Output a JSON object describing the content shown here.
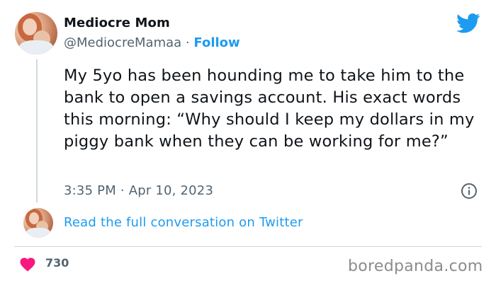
{
  "author": {
    "display_name": "Mediocre Mom",
    "handle": "@MediocreMamaa",
    "separator": "·",
    "follow_label": "Follow"
  },
  "tweet": {
    "text": "My 5yo has been hounding me to take him to the bank to open a savings account. His exact words this morning: “Why should I keep my dollars in my piggy bank when they can be working for me?”",
    "timestamp": "3:35 PM · Apr 10, 2023"
  },
  "conversation_link": "Read the full conversation on Twitter",
  "likes": {
    "count": "730"
  },
  "watermark": "boredpanda.com",
  "icons": {
    "brand": "twitter-bird-icon",
    "info": "info-icon",
    "like": "heart-icon"
  },
  "colors": {
    "link_blue": "#1d9bf0",
    "heart_pink": "#f91880",
    "muted_text": "#536471"
  }
}
